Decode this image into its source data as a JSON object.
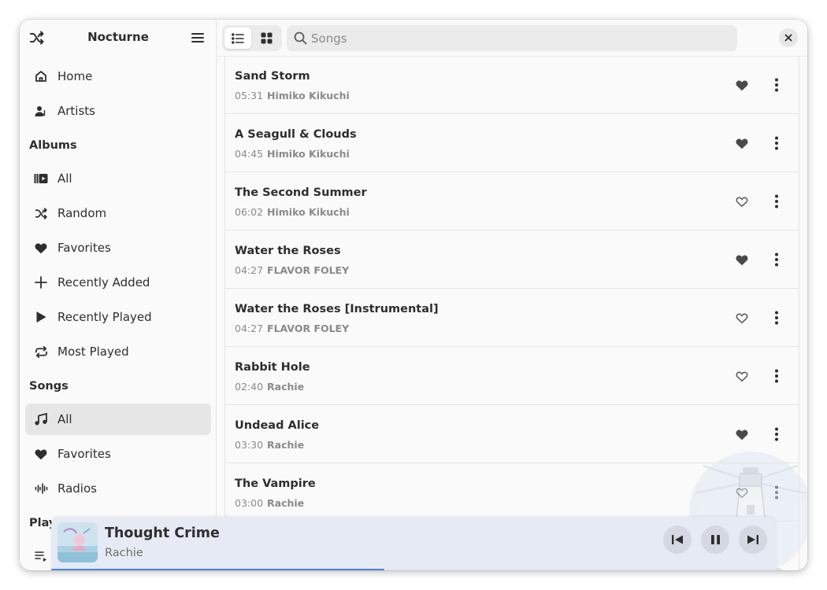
{
  "app": {
    "title": "Nocturne"
  },
  "sidebar": {
    "nav": [
      {
        "label": "Home",
        "icon": "home-icon"
      },
      {
        "label": "Artists",
        "icon": "artist-icon"
      }
    ],
    "albums_header": "Albums",
    "albums": [
      {
        "label": "All",
        "icon": "album-icon"
      },
      {
        "label": "Random",
        "icon": "shuffle-icon"
      },
      {
        "label": "Favorites",
        "icon": "heart-icon"
      },
      {
        "label": "Recently Added",
        "icon": "plus-icon"
      },
      {
        "label": "Recently Played",
        "icon": "play-icon"
      },
      {
        "label": "Most Played",
        "icon": "repeat-icon"
      }
    ],
    "songs_header": "Songs",
    "songs": [
      {
        "label": "All",
        "icon": "music-note-icon",
        "active": true
      },
      {
        "label": "Favorites",
        "icon": "heart-icon"
      },
      {
        "label": "Radios",
        "icon": "radio-wave-icon"
      }
    ],
    "playlists_header": "Playl"
  },
  "search": {
    "placeholder": "Songs",
    "value": ""
  },
  "songs": [
    {
      "title": "Sand Storm",
      "duration": "05:31",
      "artist": "Himiko Kikuchi",
      "favorite": true
    },
    {
      "title": "A Seagull & Clouds",
      "duration": "04:45",
      "artist": "Himiko Kikuchi",
      "favorite": true
    },
    {
      "title": "The Second Summer",
      "duration": "06:02",
      "artist": "Himiko Kikuchi",
      "favorite": false
    },
    {
      "title": "Water the Roses",
      "duration": "04:27",
      "artist": "FLAVOR FOLEY",
      "favorite": true
    },
    {
      "title": "Water the Roses [Instrumental]",
      "duration": "04:27",
      "artist": "FLAVOR FOLEY",
      "favorite": false
    },
    {
      "title": "Rabbit Hole",
      "duration": "02:40",
      "artist": "Rachie",
      "favorite": false
    },
    {
      "title": "Undead Alice",
      "duration": "03:30",
      "artist": "Rachie",
      "favorite": true
    },
    {
      "title": "The Vampire",
      "duration": "03:00",
      "artist": "Rachie",
      "favorite": false
    }
  ],
  "player": {
    "title": "Thought Crime",
    "artist": "Rachie",
    "progress": 0.46,
    "state": "playing"
  },
  "colors": {
    "accent": "#4a86e0",
    "player_bg": "#e5eaf4",
    "icon": "#4a4a4a"
  }
}
